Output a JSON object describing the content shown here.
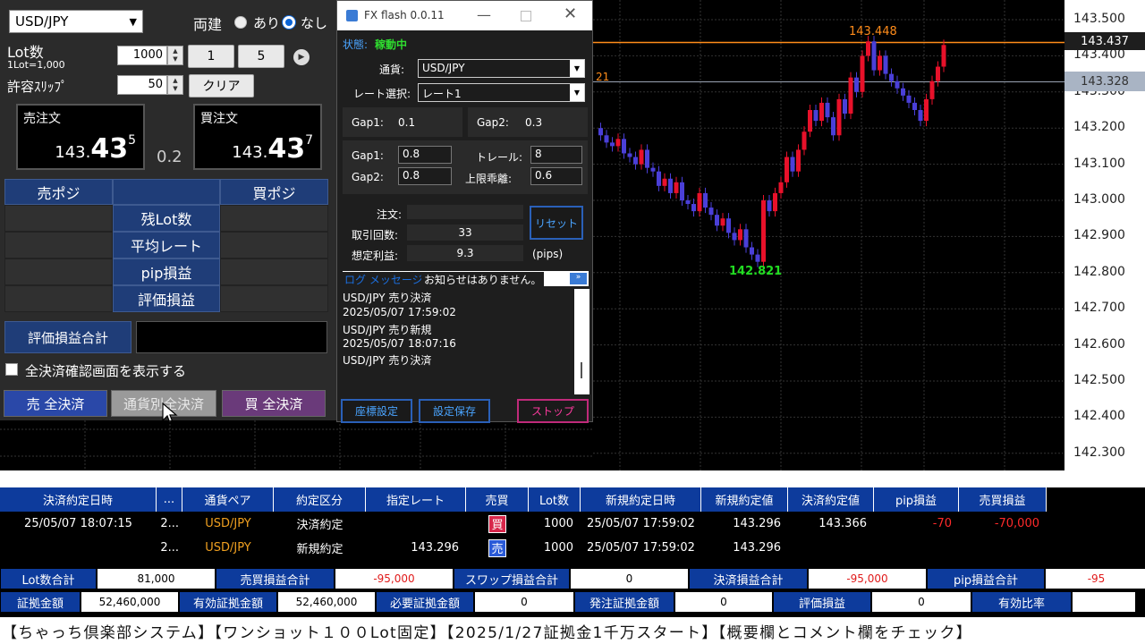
{
  "left": {
    "pair": "USD/JPY",
    "ryoudate": "両建",
    "opt_ari": "あり",
    "opt_nashi": "なし",
    "lot_label": "Lot数",
    "lot_sub": "1Lot=1,000",
    "lot_value": "1000",
    "btn1": "1",
    "btn5": "5",
    "slip_label": "許容ｽﾘｯﾌﾟ",
    "slip_value": "50",
    "clear": "クリア",
    "sell_title": "売注文",
    "sell_a": "143.",
    "sell_b": "43",
    "sell_c": "5",
    "spread": "0.2",
    "buy_title": "買注文",
    "buy_a": "143.",
    "buy_b": "43",
    "buy_c": "7",
    "grid_sell": "売ポジ",
    "grid_buy": "買ポジ",
    "rows": [
      "残Lot数",
      "平均レート",
      "pip損益",
      "評価損益"
    ],
    "total_label": "評価損益合計",
    "confirm": "全決済確認画面を表示する",
    "sell_all": "売 全決済",
    "pair_all": "通貨別全決済",
    "buy_all": "買 全決済"
  },
  "popup": {
    "title": "FX flash 0.0.11",
    "status_label": "状態:",
    "status_value": "稼動中",
    "pair_label": "通貨:",
    "pair_value": "USD/JPY",
    "rate_label": "レート選択:",
    "rate_value": "レート1",
    "gap1": "Gap1:",
    "gap1_val": "0.1",
    "gap2": "Gap2:",
    "gap2_val": "0.3",
    "in_gap1": "Gap1:",
    "in_gap1_val": "0.8",
    "trail": "トレール:",
    "trail_val": "8",
    "in_gap2": "Gap2:",
    "in_gap2_val": "0.8",
    "limit": "上限乖離:",
    "limit_val": "0.6",
    "order": "注文:",
    "count_label": "取引回数:",
    "count": "33",
    "profit_label": "想定利益:",
    "profit": "9.3",
    "pips": "(pips)",
    "reset": "リセット",
    "log_label": "ログ メッセージ:",
    "log_msg": "お知らせはありません。",
    "logs": [
      "USD/JPY 売り決済",
      "2025/05/07 17:59:02",
      "USD/JPY 売り新規",
      "2025/05/07 18:07:16",
      "USD/JPY 売り決済"
    ],
    "coord": "座標設定",
    "save": "設定保存",
    "stop": "ストップ"
  },
  "chart": {
    "high_label": "143.448",
    "low_label": "142.821",
    "left_tag": "21",
    "ask_tag": "143.437",
    "bid_tag": "143.328",
    "ticks": [
      "143.500",
      "143.400",
      "143.300",
      "143.200",
      "143.100",
      "143.000",
      "142.900",
      "142.800",
      "142.700",
      "142.600",
      "142.500",
      "142.400",
      "142.300"
    ],
    "colors": {
      "up": "#e8112a",
      "down": "#4a3fd8",
      "high": "#ff8c1a",
      "low": "#22dd22"
    }
  },
  "table": {
    "headers": [
      "決済約定日時",
      "...",
      "通貨ペア",
      "約定区分",
      "指定レート",
      "売買",
      "Lot数",
      "新規約定日時",
      "新規約定値",
      "決済約定値",
      "pip損益",
      "売買損益"
    ],
    "rows": [
      [
        "25/05/07 18:07:15",
        "2...",
        "USD/JPY",
        "決済約定",
        "",
        "買",
        "1000",
        "25/05/07 17:59:02",
        "143.296",
        "143.366",
        "-70",
        "-70,000"
      ],
      [
        "",
        "2...",
        "USD/JPY",
        "新規約定",
        "143.296",
        "売",
        "1000",
        "25/05/07 17:59:02",
        "143.296",
        "",
        "",
        ""
      ]
    ]
  },
  "summary": {
    "r1": [
      [
        "Lot数合計",
        "81,000"
      ],
      [
        "売買損益合計",
        "-95,000"
      ],
      [
        "スワップ損益合計",
        "0"
      ],
      [
        "決済損益合計",
        "-95,000"
      ],
      [
        "pip損益合計",
        "-95"
      ]
    ],
    "r2": [
      [
        "証拠金額",
        "52,460,000"
      ],
      [
        "有効証拠金額",
        "52,460,000"
      ],
      [
        "必要証拠金額",
        "0"
      ],
      [
        "発注証拠金額",
        "0"
      ],
      [
        "評価損益",
        "0"
      ],
      [
        "有効比率",
        ""
      ]
    ]
  },
  "footer": "【ちゃっち倶楽部システム】【ワンショット１００Lot固定】【2025/1/27証拠金1千万スタート】【概要欄とコメント欄をチェック】"
}
